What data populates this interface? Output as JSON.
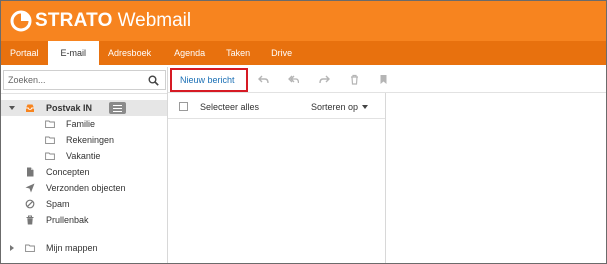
{
  "app": {
    "brand_name": "STRATO",
    "product_name": "Webmail",
    "brand_color": "#f7841f",
    "nav_color": "#e8710e"
  },
  "nav": {
    "tabs": [
      {
        "label": "Portaal",
        "active": false
      },
      {
        "label": "E-mail",
        "active": true
      },
      {
        "label": "Adresboek",
        "active": false
      },
      {
        "label": "Agenda",
        "active": false
      },
      {
        "label": "Taken",
        "active": false
      },
      {
        "label": "Drive",
        "active": false
      }
    ]
  },
  "search": {
    "placeholder": "Zoeken...",
    "icon": "search-icon"
  },
  "toolbar": {
    "new_message_label": "Nieuw bericht",
    "highlight_color": "#d61a24",
    "icons": [
      "reply-icon",
      "reply-all-icon",
      "forward-icon",
      "trash-icon",
      "bookmark-icon"
    ]
  },
  "message_list": {
    "select_all_label": "Selecteer alles",
    "sort_label": "Sorteren op"
  },
  "folders": {
    "inbox": {
      "label": "Postvak IN",
      "icon": "inbox-icon",
      "expanded": true
    },
    "subfolders": [
      {
        "label": "Familie",
        "icon": "folder-icon"
      },
      {
        "label": "Rekeningen",
        "icon": "folder-icon"
      },
      {
        "label": "Vakantie",
        "icon": "folder-icon"
      }
    ],
    "system": [
      {
        "label": "Concepten",
        "icon": "draft-icon"
      },
      {
        "label": "Verzonden objecten",
        "icon": "send-icon"
      },
      {
        "label": "Spam",
        "icon": "block-icon"
      },
      {
        "label": "Prullenbak",
        "icon": "trash-icon"
      }
    ],
    "my_folders": {
      "label": "Mijn mappen",
      "icon": "folder-icon",
      "expanded": false
    }
  }
}
